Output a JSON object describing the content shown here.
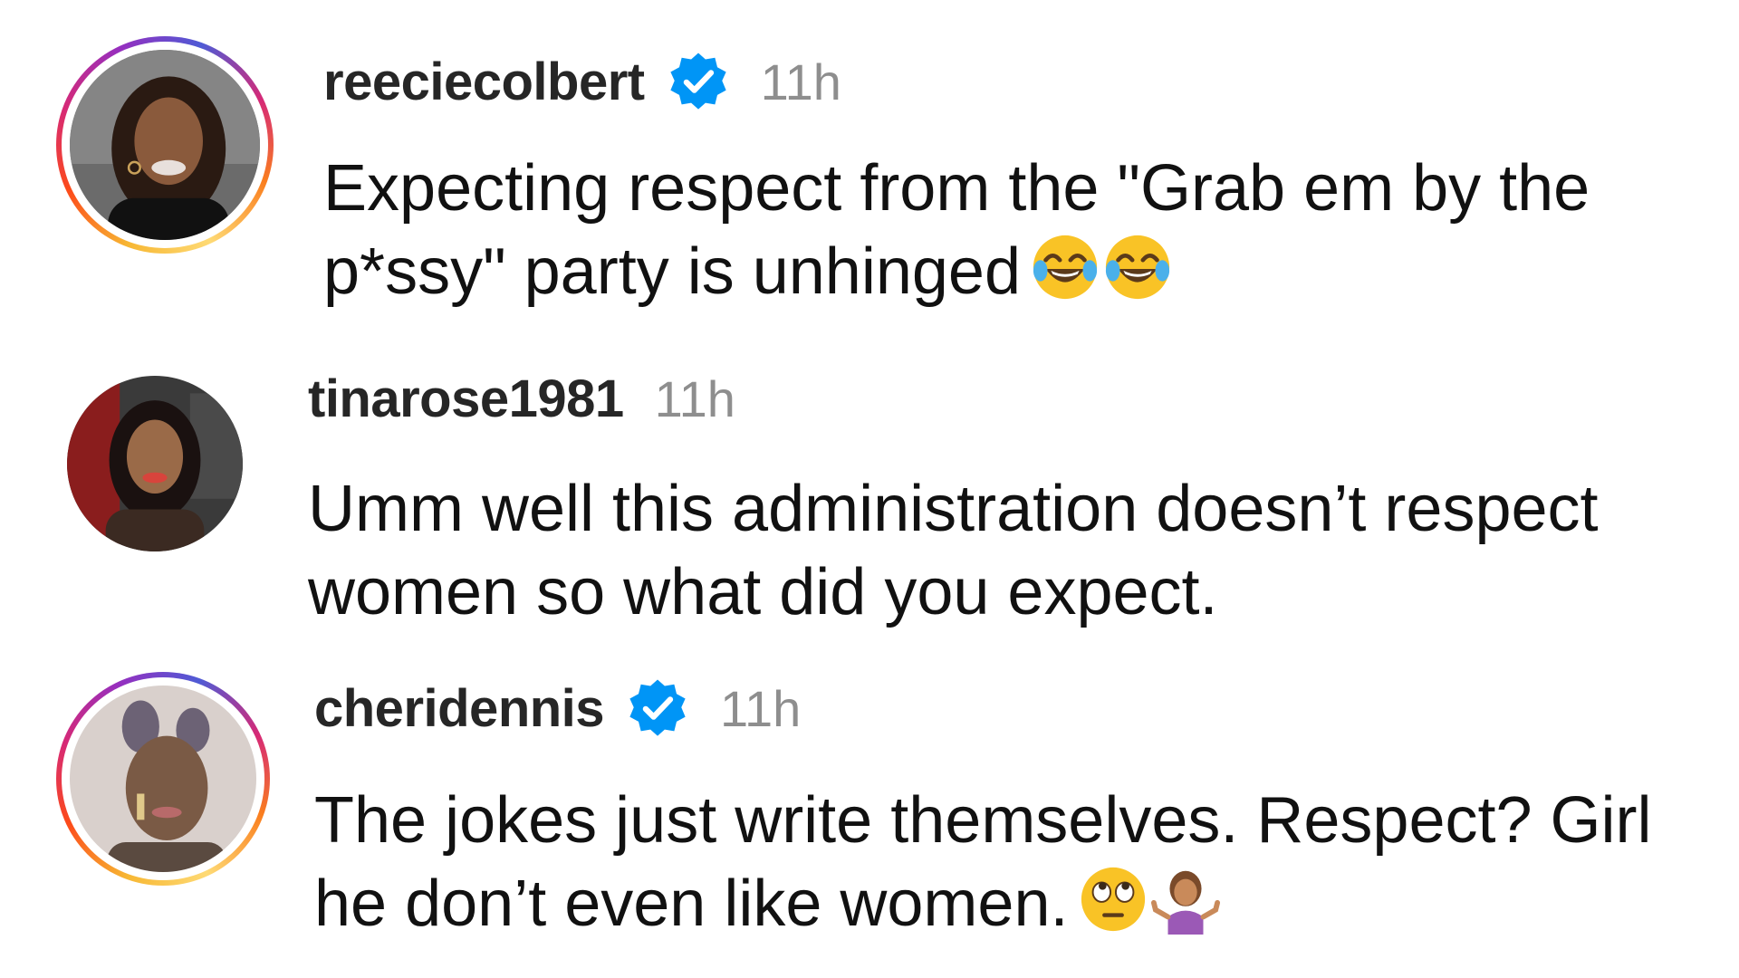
{
  "comments": [
    {
      "username": "reeciecolbert",
      "verified": true,
      "time": "11h",
      "text": "Expecting respect from the \"Grab em by the p*ssy\" party is unhinged",
      "emojis": [
        "face-with-tears-of-joy-icon",
        "face-with-tears-of-joy-icon"
      ],
      "has_story_ring": true
    },
    {
      "username": "tinarose1981",
      "verified": false,
      "time": "11h",
      "text": "Umm well this administration doesn’t respect women so what did you expect.",
      "emojis": [],
      "has_story_ring": false
    },
    {
      "username": "cheridennis",
      "verified": true,
      "time": "11h",
      "text": "The jokes just write themselves. Respect? Girl he don’t even like women.",
      "emojis": [
        "face-with-rolling-eyes-icon",
        "person-shrugging-icon"
      ],
      "has_story_ring": true
    }
  ],
  "colors": {
    "username": "#262626",
    "timestamp": "#8e8e8e",
    "verified_badge": "#0095f6",
    "text": "#111111"
  }
}
